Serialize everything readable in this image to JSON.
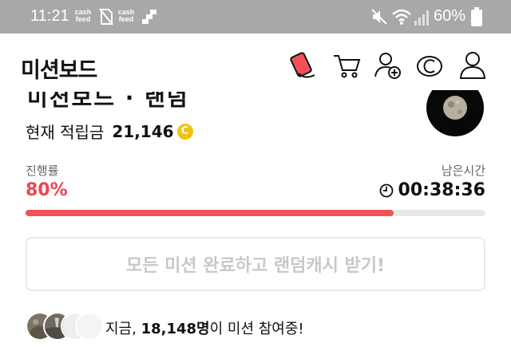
{
  "status_bar": {
    "time": "11:21",
    "notif_label_1": "cash\nfeed",
    "notif_label_2": "cash\nfeed",
    "battery": "60%"
  },
  "header": {
    "title": "미션보드",
    "icons": [
      "sticker-icon",
      "cart-icon",
      "add-friend-icon",
      "coin-icon",
      "profile-icon"
    ]
  },
  "mission": {
    "cut_title": "미션보드 · 랜덤캐시",
    "reward_label": "현재 적립금",
    "reward_amount": "21,146",
    "coin_symbol": "C"
  },
  "progress": {
    "label": "진행률",
    "percent_text": "80%",
    "value": 0.8,
    "remain_label": "남은시간",
    "remain_time": "00:38:36"
  },
  "cta": {
    "label": "모든 미션 완료하고 랜덤캐시 받기!"
  },
  "participants": {
    "prefix": "지금, ",
    "count": "18,148명",
    "suffix": "이 미션 참여중!"
  },
  "colors": {
    "accent": "#f0444f",
    "bar": "#f25157",
    "coin": "#f4c20d",
    "status_bar": "#a8a8a8"
  }
}
